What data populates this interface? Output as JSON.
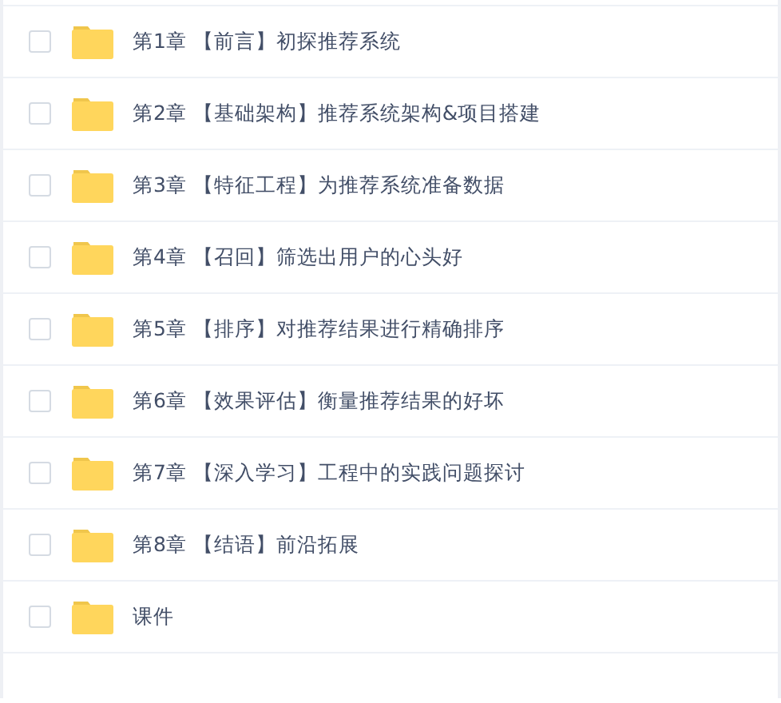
{
  "files": [
    {
      "name": "第1章 【前言】初探推荐系统",
      "checked": false
    },
    {
      "name": "第2章 【基础架构】推荐系统架构&项目搭建",
      "checked": false
    },
    {
      "name": "第3章 【特征工程】为推荐系统准备数据",
      "checked": false
    },
    {
      "name": "第4章 【召回】筛选出用户的心头好",
      "checked": false
    },
    {
      "name": "第5章 【排序】对推荐结果进行精确排序",
      "checked": false
    },
    {
      "name": "第6章 【效果评估】衡量推荐结果的好坏",
      "checked": false
    },
    {
      "name": "第7章 【深入学习】工程中的实践问题探讨",
      "checked": false
    },
    {
      "name": "第8章 【结语】前沿拓展",
      "checked": false
    },
    {
      "name": "课件",
      "checked": false
    }
  ]
}
